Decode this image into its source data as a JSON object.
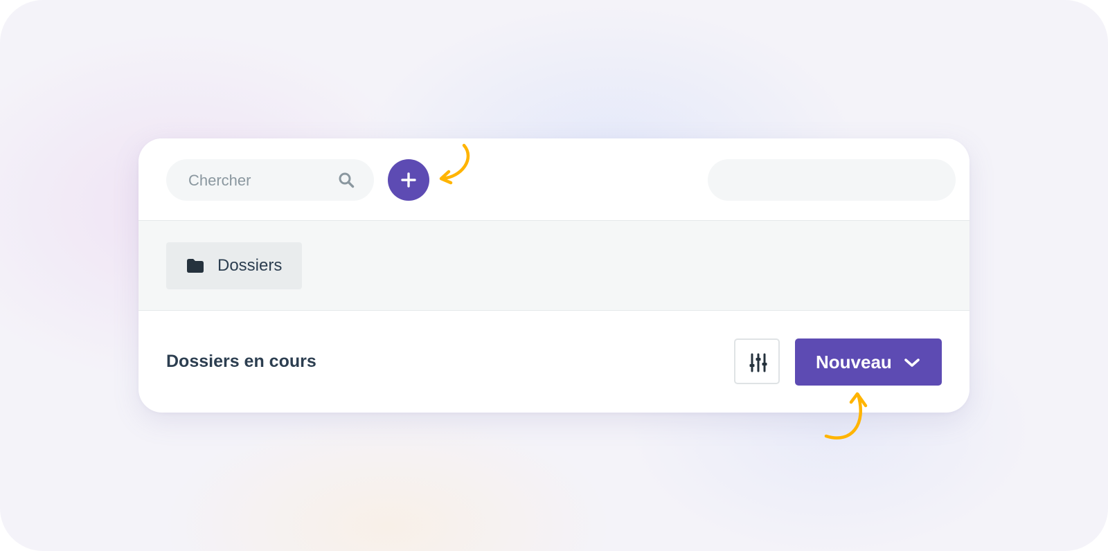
{
  "colors": {
    "accent": "#5d4bb3",
    "annotation_arrow": "#ffb400",
    "text_dark": "#2c3e50",
    "placeholder": "#8a979f"
  },
  "search": {
    "placeholder": "Chercher",
    "value": "",
    "icon": "search-icon"
  },
  "toolbar": {
    "add_icon": "plus-icon"
  },
  "folders": {
    "tab_label": "Dossiers",
    "tab_icon": "folder-icon"
  },
  "section": {
    "title": "Dossiers en cours",
    "filter_icon": "sliders-icon",
    "new_button_label": "Nouveau",
    "new_button_icon": "chevron-down-icon"
  }
}
